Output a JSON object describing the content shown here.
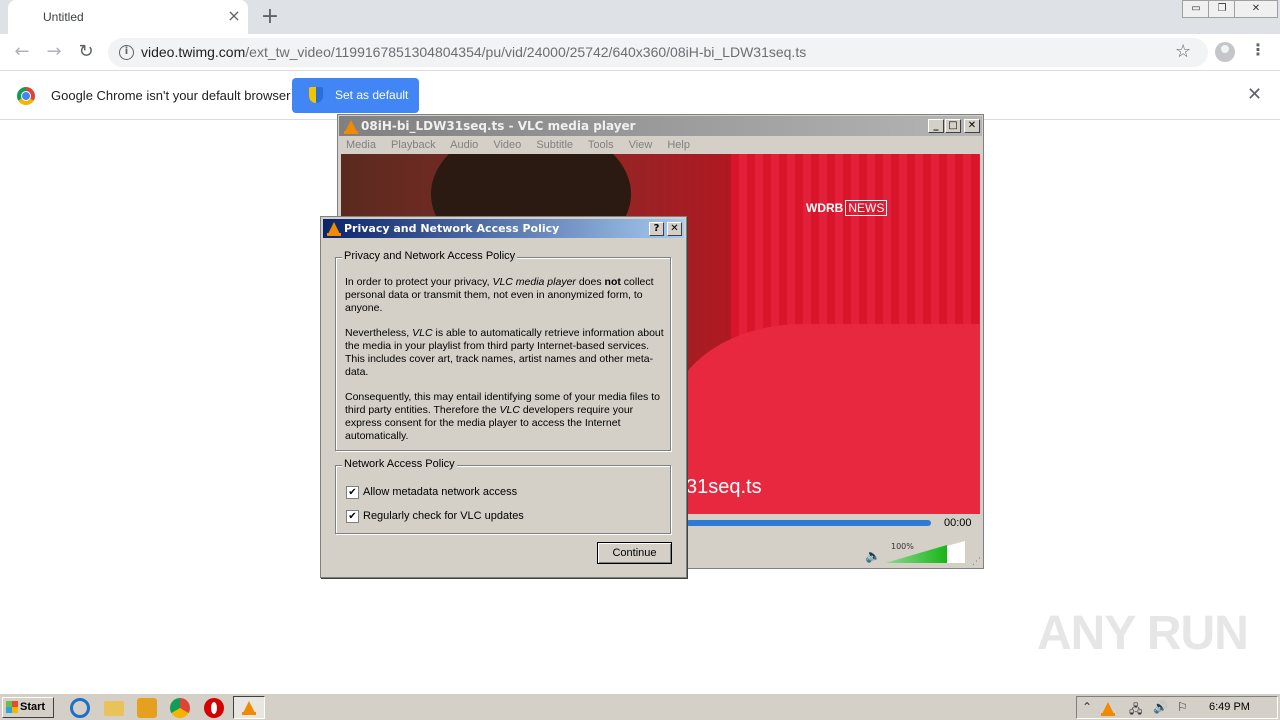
{
  "browser": {
    "tab_title": "Untitled",
    "tab_close": "×",
    "new_tab": "+",
    "window_controls": {
      "minimize": "▭",
      "restore": "❐",
      "close": "✕"
    },
    "url_host": "video.twimg.com",
    "url_path": "/ext_tw_video/1199167851304804354/pu/vid/24000/25742/640x360/08iH-bi_LDW31seq.ts",
    "nav": {
      "back": "←",
      "forward": "→",
      "reload": "↻"
    },
    "star": "☆",
    "menu": "⋮",
    "infobar": {
      "message": "Google Chrome isn't your default browser",
      "button": "Set as default",
      "close": "✕"
    }
  },
  "vlc": {
    "title": "08iH-bi_LDW31seq.ts - VLC media player",
    "menu": [
      "Media",
      "Playback",
      "Audio",
      "Video",
      "Subtitle",
      "Tools",
      "View",
      "Help"
    ],
    "title_buttons": {
      "minimize": "_",
      "maximize": "□",
      "close": "✕"
    },
    "logo_text": "WDRB",
    "logo_news": "NEWS",
    "caption": "31seq.ts",
    "time": "00:00",
    "volume_label": "100%",
    "volume_level": 1.0,
    "speaker": "🔈",
    "grip": "⋰"
  },
  "dialog": {
    "title": "Privacy and Network Access Policy",
    "help_button": "?",
    "close_button": "✕",
    "group1_title": "Privacy and Network Access Policy",
    "p1_a": "In order to protect your privacy, ",
    "p1_app": "VLC media player",
    "p1_b": " does ",
    "p1_not": "not",
    "p1_c": " collect personal data or transmit them, not even in anonymized form, to anyone.",
    "p2_a": "Nevertheless, ",
    "p2_app": "VLC",
    "p2_b": " is able to automatically retrieve information about the media in your playlist from third party Internet-based services. This includes cover art, track names, artist names and other meta-data.",
    "p3_a": "Consequently, this may entail identifying some of your media files to third party entities. Therefore the ",
    "p3_app": "VLC",
    "p3_b": " developers require your express consent for the media player to access the Internet automatically.",
    "group2_title": "Network Access Policy",
    "check1": "Allow metadata network access",
    "check2": "Regularly check for VLC updates",
    "check_mark": "✔",
    "continue": "Continue"
  },
  "watermark": "ANY RUN",
  "taskbar": {
    "start": "Start",
    "clock": "6:49 PM",
    "tray_arrow": "⌃",
    "tray_network": "🖧",
    "tray_volume": "🔊",
    "tray_flag": "⚐"
  }
}
